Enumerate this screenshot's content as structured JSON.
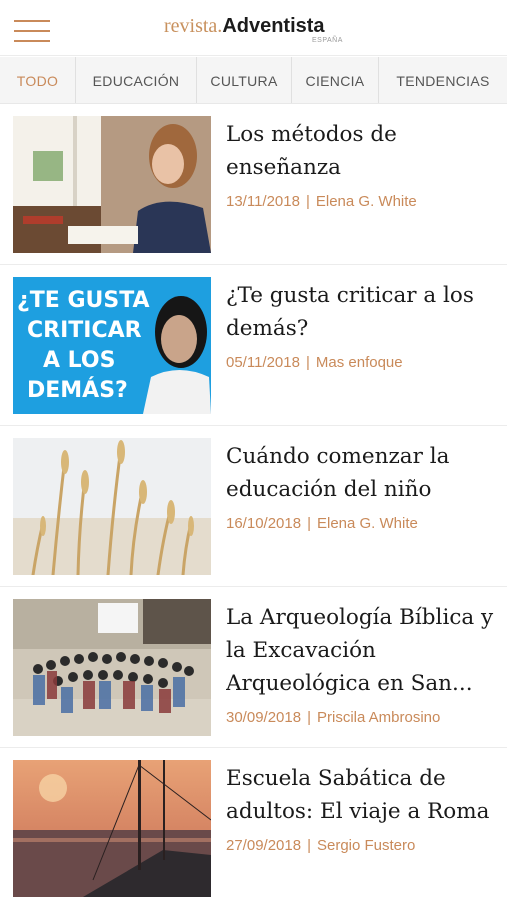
{
  "header": {
    "logo_light": "revista.",
    "logo_bold": "Adventista",
    "logo_sub": "ESPAÑA"
  },
  "tabs": [
    {
      "label": "TODO",
      "active": true
    },
    {
      "label": "EDUCACIÓN",
      "active": false
    },
    {
      "label": "CULTURA",
      "active": false
    },
    {
      "label": "CIENCIA",
      "active": false
    },
    {
      "label": "TENDENCIAS",
      "active": false
    }
  ],
  "articles": [
    {
      "title": "Los métodos de enseñanza",
      "date": "13/11/2018",
      "separator": "|",
      "author": "Elena G. White"
    },
    {
      "title": "¿Te gusta criticar a los demás?",
      "date": "05/11/2018",
      "separator": "|",
      "author": "Mas enfoque",
      "thumb_text": [
        "¿TE GUSTA",
        "CRITICAR",
        "A LOS",
        "DEMÁS?"
      ]
    },
    {
      "title": "Cuándo comenzar la educación del niño",
      "date": "16/10/2018",
      "separator": "|",
      "author": "Elena G. White"
    },
    {
      "title": "La Arqueología Bíblica y la Excavación Arqueológica en San...",
      "date": "30/09/2018",
      "separator": "|",
      "author": "Priscila Ambrosino"
    },
    {
      "title": "Escuela Sabática de adultos: El viaje a Roma",
      "date": "27/09/2018",
      "separator": "|",
      "author": "Sergio Fustero"
    }
  ],
  "colors": {
    "accent": "#c98a5a",
    "tab_bar_bg": "#f5f5f5",
    "thumb2_bg": "#1e9fe0"
  }
}
